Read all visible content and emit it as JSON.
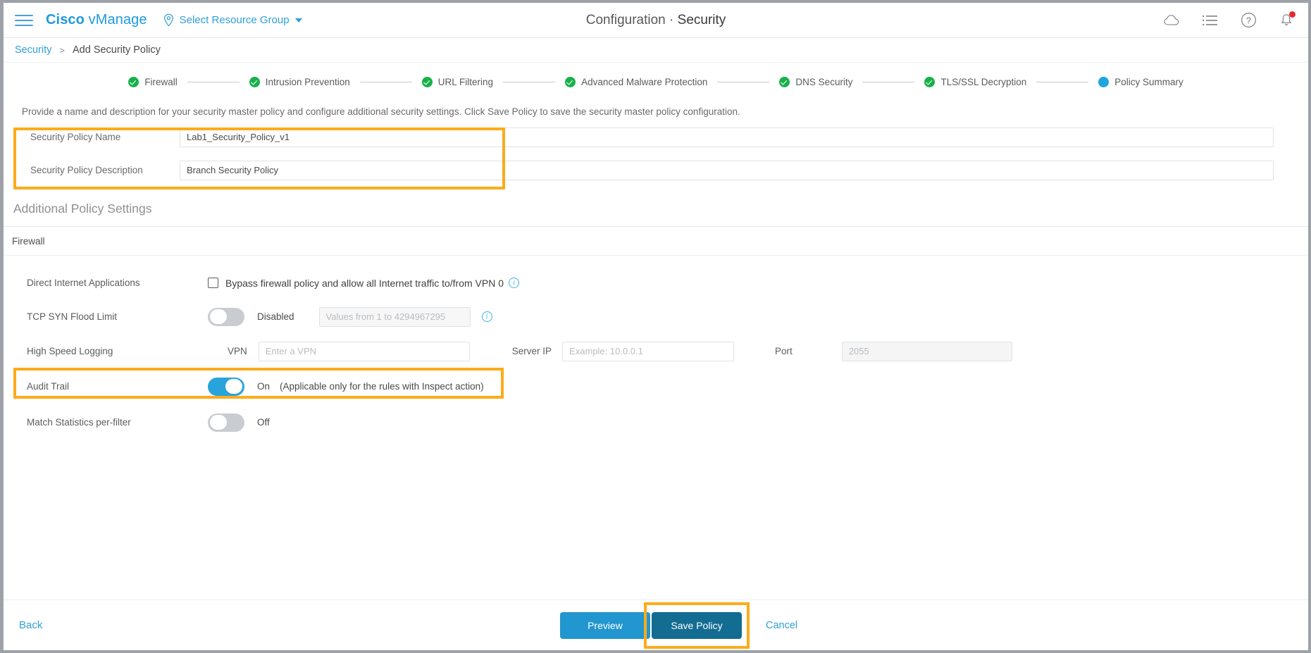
{
  "header": {
    "menu_icon": "hamburger-icon",
    "brand_bold": "Cisco",
    "brand_light": "vManage",
    "resource_group": "Select Resource Group",
    "title_primary": "Configuration",
    "title_separator": "·",
    "title_secondary": "Security",
    "icons": [
      "cloud-icon",
      "list-icon",
      "help-icon",
      "notification-bell-icon"
    ]
  },
  "breadcrumb": {
    "root": "Security",
    "separator": ">",
    "current": "Add Security Policy"
  },
  "stepper": {
    "steps": [
      {
        "label": "Firewall",
        "state": "done"
      },
      {
        "label": "Intrusion Prevention",
        "state": "done"
      },
      {
        "label": "URL Filtering",
        "state": "done"
      },
      {
        "label": "Advanced Malware Protection",
        "state": "done"
      },
      {
        "label": "DNS Security",
        "state": "done"
      },
      {
        "label": "TLS/SSL Decryption",
        "state": "done"
      },
      {
        "label": "Policy Summary",
        "state": "current"
      }
    ]
  },
  "intro_text": "Provide a name and description for your security master policy and configure additional security settings. Click Save Policy to save the security master policy configuration.",
  "policy": {
    "name_label": "Security Policy Name",
    "name_value": "Lab1_Security_Policy_v1",
    "description_label": "Security Policy Description",
    "description_value": "Branch Security Policy"
  },
  "additional_settings": {
    "title": "Additional Policy Settings",
    "subsection": "Firewall",
    "direct_internet": {
      "label": "Direct Internet Applications",
      "checkbox_label": "Bypass firewall policy and allow all Internet traffic to/from VPN 0",
      "checked": false,
      "info": "i"
    },
    "tcp_syn": {
      "label": "TCP SYN Flood Limit",
      "toggle_state": "Disabled",
      "toggle_on": false,
      "input_placeholder": "Values from 1 to 4294967295",
      "input_value": "",
      "info": "i"
    },
    "high_speed_logging": {
      "label": "High Speed Logging",
      "vpn_label": "VPN",
      "vpn_placeholder": "Enter a VPN",
      "vpn_value": "",
      "server_ip_label": "Server IP",
      "server_ip_placeholder": "Example: 10.0.0.1",
      "server_ip_value": "",
      "port_label": "Port",
      "port_placeholder": "2055",
      "port_value": ""
    },
    "audit_trail": {
      "label": "Audit Trail",
      "toggle_state": "On",
      "toggle_on": true,
      "note": "(Applicable only for the rules with Inspect action)"
    },
    "match_statistics": {
      "label": "Match Statistics per-filter",
      "toggle_state": "Off",
      "toggle_on": false
    }
  },
  "footer": {
    "back": "Back",
    "preview": "Preview",
    "save": "Save Policy",
    "cancel": "Cancel"
  },
  "colors": {
    "highlight": "#fcab1b",
    "accent_blue": "#2f9fd8",
    "save_blue": "#136c92",
    "step_done_green": "#19b04b",
    "step_current_blue": "#1fa5e0"
  }
}
